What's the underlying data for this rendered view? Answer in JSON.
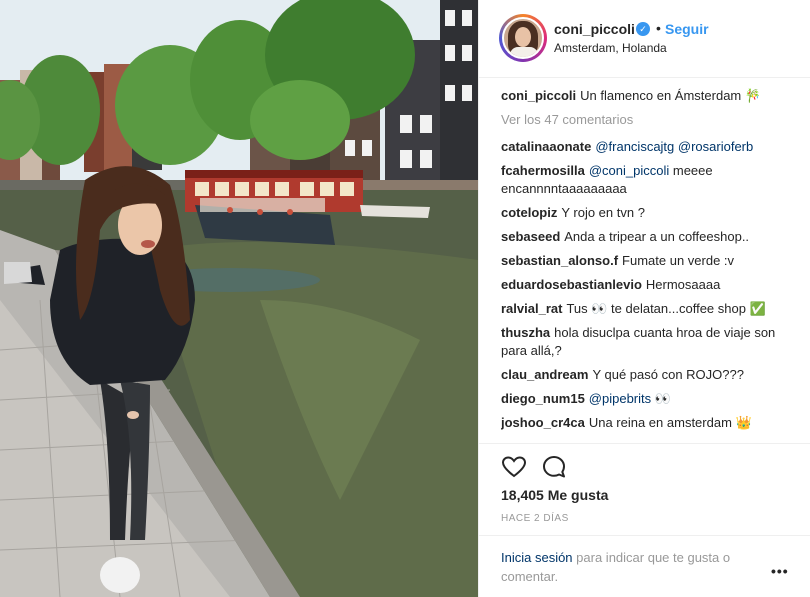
{
  "post": {
    "username": "coni_piccoli",
    "verified_mark": "✓",
    "separator": "•",
    "follow_label": "Seguir",
    "location": "Amsterdam, Holanda",
    "avatar_icon": "profile-avatar"
  },
  "caption": {
    "user": "coni_piccoli",
    "text": "Un flamenco en Ámsterdam 🎋"
  },
  "view_comments": "Ver los 47 comentarios",
  "comments": [
    {
      "user": "catalinaaonate",
      "mentions": [
        "@franciscajtg",
        "@rosarioferb"
      ]
    },
    {
      "user": "fcahermosilla",
      "mention": "@coni_piccoli",
      "text": "meeee encannnntaaaaaaaaa"
    },
    {
      "user": "cotelopiz",
      "text": "Y rojo en tvn ?"
    },
    {
      "user": "sebaseed",
      "text": "Anda a tripear a un coffeeshop.."
    },
    {
      "user": "sebastian_alonso.f",
      "text": "Fumate un verde :v"
    },
    {
      "user": "eduardosebastianlevio",
      "text": "Hermosaaaa"
    },
    {
      "user": "ralvial_rat",
      "text": "Tus 👀 te delatan...coffee shop ✅"
    },
    {
      "user": "thuszha",
      "text": "hola disuclpa cuanta hroa de viaje son para allá,?"
    },
    {
      "user": "clau_andream",
      "text": "Y qué pasó con ROJO???"
    },
    {
      "user": "diego_num15",
      "mention": "@pipebrits",
      "text": "👀"
    },
    {
      "user": "joshoo_cr4ca",
      "text": "Una reina en amsterdam 👑"
    }
  ],
  "actions": {
    "like_icon": "heart-outline",
    "comment_icon": "speech-bubble",
    "likes": "18,405 Me gusta",
    "time": "HACE 2 DÍAS"
  },
  "login": {
    "link": "Inicia sesión",
    "text": "para indicar que te gusta o comentar.",
    "options": "•••"
  },
  "colors": {
    "accent": "#3897f0",
    "mention": "#003569",
    "muted": "#999999"
  }
}
